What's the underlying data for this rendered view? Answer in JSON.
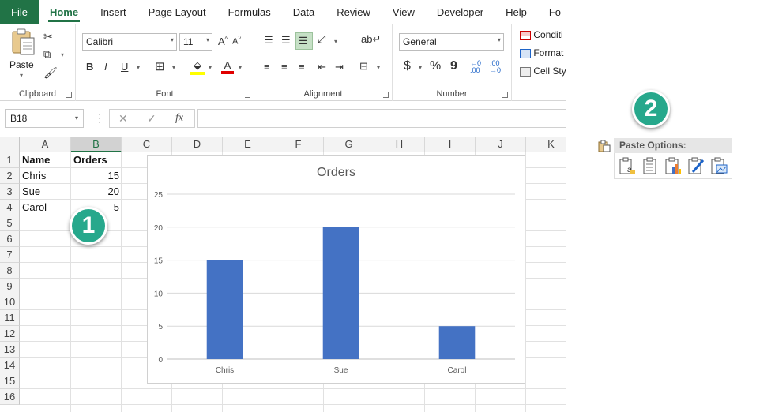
{
  "ribbon": {
    "tabs": [
      "File",
      "Home",
      "Insert",
      "Page Layout",
      "Formulas",
      "Data",
      "Review",
      "View",
      "Developer",
      "Help",
      "Fo"
    ],
    "clipboard": {
      "paste_label": "Paste",
      "group_label": "Clipboard"
    },
    "font": {
      "name": "Calibri",
      "size": "11",
      "grow": "A^",
      "shrink": "A˅",
      "bold": "B",
      "italic": "I",
      "underline": "U",
      "group_label": "Font"
    },
    "alignment": {
      "group_label": "Alignment"
    },
    "number": {
      "format": "General",
      "dollar": "$",
      "percent": "%",
      "comma": "9",
      "group_label": "Number"
    },
    "styles": {
      "conditional": "Conditi",
      "format_as": "Format",
      "cell_styles": "Cell Sty"
    }
  },
  "formula_bar": {
    "name_box": "B18",
    "fx": "fx",
    "cancel": "✕",
    "enter": "✓",
    "formula": ""
  },
  "sheet": {
    "columns": [
      "A",
      "B",
      "C",
      "D",
      "E",
      "F",
      "G",
      "H",
      "I",
      "J",
      "K"
    ],
    "selected_column": "B",
    "rows": [
      "1",
      "2",
      "3",
      "4",
      "5",
      "6",
      "7",
      "8",
      "9",
      "10",
      "11",
      "12",
      "13",
      "14",
      "15",
      "16"
    ],
    "cells": {
      "A1": "Name",
      "B1": "Orders",
      "A2": "Chris",
      "B2": "15",
      "A3": "Sue",
      "B3": "20",
      "A4": "Carol",
      "B4": "5"
    }
  },
  "chart_data": {
    "type": "bar",
    "title": "Orders",
    "categories": [
      "Chris",
      "Sue",
      "Carol"
    ],
    "values": [
      15,
      20,
      5
    ],
    "ylim": [
      0,
      25
    ],
    "yticks": [
      0,
      5,
      10,
      15,
      20,
      25
    ],
    "grid": true,
    "bar_color": "#4472c4",
    "xlabel": "",
    "ylabel": ""
  },
  "badges": {
    "one": "1",
    "two": "2"
  },
  "paste_options": {
    "header": "Paste Options:",
    "icons": [
      "paste-keep-text-icon",
      "paste-icon",
      "paste-chart-icon",
      "paste-formatting-icon",
      "paste-picture-icon"
    ]
  },
  "colors": {
    "accent": "#217346",
    "badge": "#27a88c",
    "bar": "#4472c4"
  }
}
